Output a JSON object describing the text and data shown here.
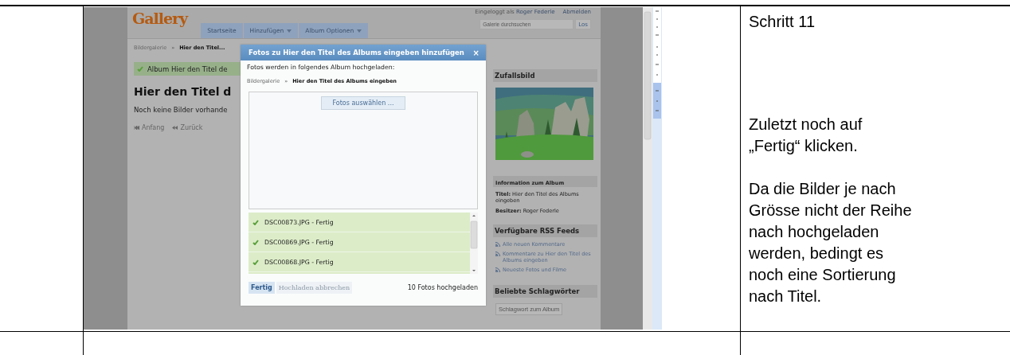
{
  "document": {
    "step_title": "Schritt 11",
    "paragraphs": [
      "Zuletzt noch auf „Fertig“ klicken.",
      "Da die Bilder je nach Grösse nicht der Reihe nach hochgeladen werden, bedingt es noch eine Sortierung nach Titel."
    ]
  },
  "screenshot": {
    "header": {
      "logo": "Gallery",
      "tabs": [
        {
          "label": "Startseite",
          "has_menu": false
        },
        {
          "label": "Hinzufügen",
          "has_menu": true
        },
        {
          "label": "Album Optionen",
          "has_menu": true
        }
      ],
      "login_prefix": "Eingeloggt als",
      "user": "Roger Federle",
      "logout": "Abmelden",
      "search": {
        "placeholder": "Galerie durchsuchen"
      },
      "search_button": "Los"
    },
    "breadcrumb": [
      "Bildergalerie",
      "Hier den Titel..."
    ],
    "breadcrumb_separator": "»",
    "message": "Album Hier den Titel de",
    "heading": "Hier den Titel d",
    "empty_text": "Noch keine Bilder vorhande",
    "pager": [
      {
        "label": "Anfang",
        "disabled": true
      },
      {
        "label": "Zurück",
        "disabled": true
      }
    ],
    "sidebar": {
      "random_title": "Zufallsbild",
      "info_title": "Information zum Album",
      "info": [
        {
          "label": "Titel:",
          "value": "Hier den Titel des Albums eingeben"
        },
        {
          "label": "Besitzer:",
          "value": "Roger Federle"
        }
      ],
      "rss_title": "Verfügbare RSS Feeds",
      "rss_links": [
        "Alle neuen Kommentare",
        "Kommentare zu Hier den Titel des Albums eingeben",
        "Neueste Fotos und Filme"
      ],
      "tags_title": "Beliebte Schlagwörter",
      "tag_button": "Schlagwort zum Album"
    },
    "dialog": {
      "title": "Fotos zu Hier den Titel des Albums eingeben hinzufügen",
      "close": "×",
      "intro": "Fotos werden in folgendes Album hochgeladen:",
      "breadcrumb": [
        "Bildergalerie",
        "Hier den Titel des Albums eingeben"
      ],
      "breadcrumb_separator": "»",
      "select_button": "Fotos auswählen ...",
      "files": [
        {
          "name": "DSC00873.JPG - Fertig",
          "done": true
        },
        {
          "name": "DSC00869.JPG - Fertig",
          "done": true
        },
        {
          "name": "DSC00868.JPG - Fertig",
          "done": true
        }
      ],
      "buttons": [
        {
          "label": "Fertig",
          "disabled": false
        },
        {
          "label": "Hochladen abbrechen",
          "disabled": true
        }
      ],
      "status": "10 Fotos hochgeladen"
    }
  }
}
